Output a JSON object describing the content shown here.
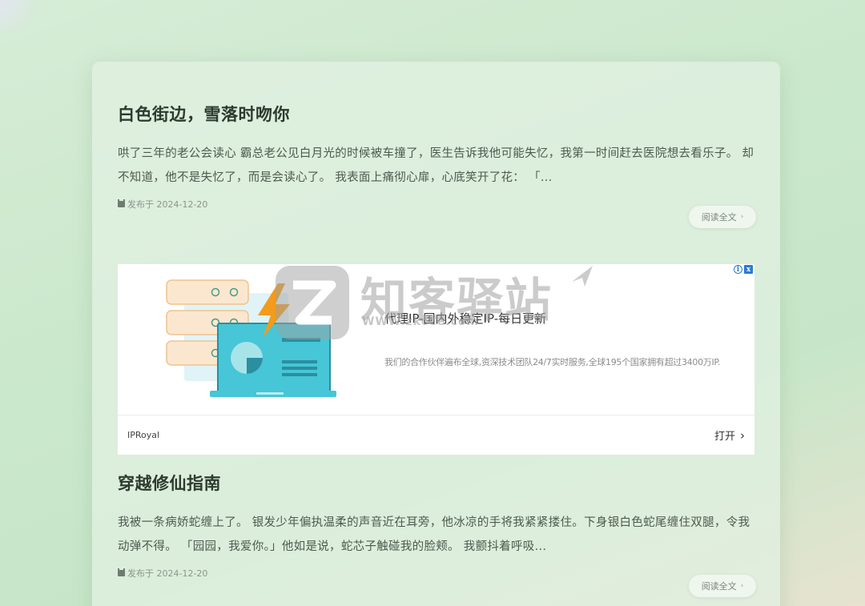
{
  "posts": [
    {
      "title": "白色街边，雪落时吻你",
      "excerpt": "哄了三年的老公会读心 霸总老公见白月光的时候被车撞了，医生告诉我他可能失忆，我第一时间赶去医院想去看乐子。 却不知道，他不是失忆了，而是会读心了。 我表面上痛彻心扉，心底笑开了花： 「...",
      "meta": "发布于 2024-12-20",
      "read_more": "阅读全文"
    },
    {
      "title": "穿越修仙指南",
      "excerpt": "我被一条病娇蛇缠上了。 银发少年偏执温柔的声音近在耳旁，他冰凉的手将我紧紧搂住。下身银白色蛇尾缠住双腿，令我动弹不得。 「园园，我爱你。」他如是说，蛇芯子触碰我的脸颊。 我颤抖着呼吸...",
      "meta": "发布于 2024-12-20",
      "read_more": "阅读全文"
    }
  ],
  "ad": {
    "headline": "代理IP-国内外稳定IP-每日更新",
    "description": "我们的合作伙伴遍布全球,资深技术团队24/7实时服务,全球195个国家拥有超过3400万IP.",
    "brand": "IPRoyal",
    "cta": "打开",
    "info_icon": "i",
    "close_icon": "x"
  },
  "watermark": {
    "text": "知客驿站",
    "url": "WWW.zkcee.com"
  },
  "colors": {
    "background": "#cbe8cc",
    "card": "#e2f0e2",
    "title": "#2d3a2e",
    "ad_accent": "#2a7bd5"
  }
}
